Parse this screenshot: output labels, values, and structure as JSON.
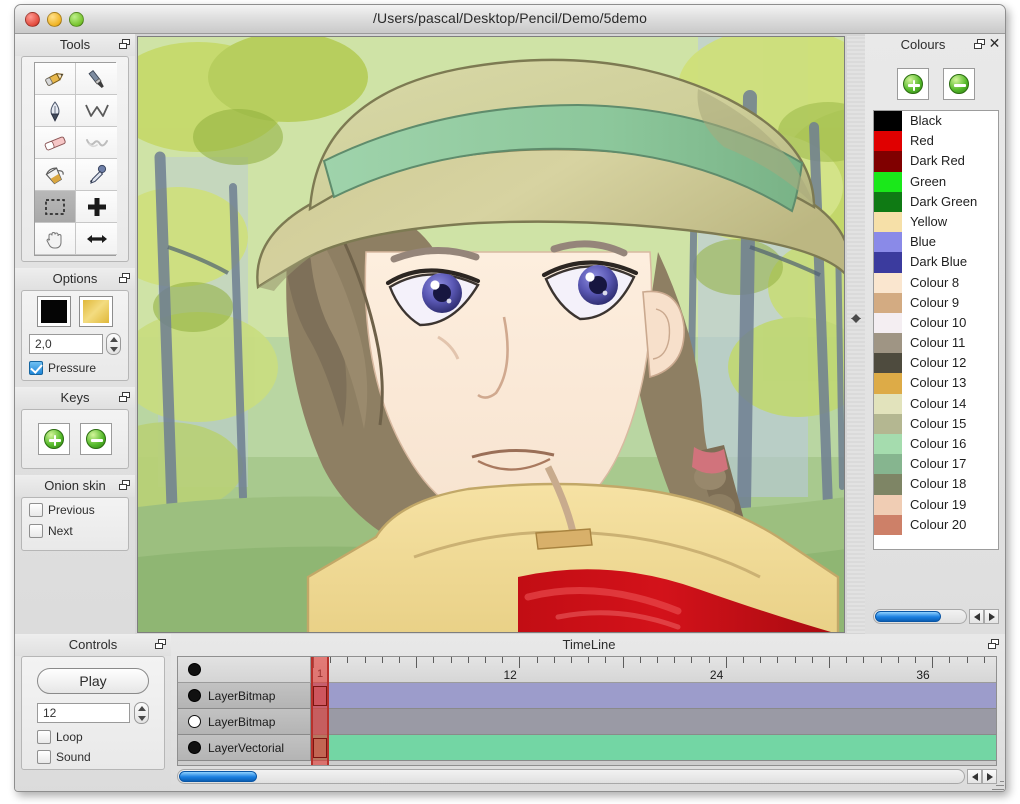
{
  "window": {
    "title": "/Users/pascal/Desktop/Pencil/Demo/5demo",
    "traffic_lights": [
      "close",
      "minimize",
      "maximize"
    ]
  },
  "tools_panel": {
    "title": "Tools",
    "items": [
      {
        "name": "pencil",
        "label": "Pencil",
        "active": false
      },
      {
        "name": "brush",
        "label": "Brush",
        "active": false
      },
      {
        "name": "pen",
        "label": "Pen",
        "active": false
      },
      {
        "name": "polyline",
        "label": "Polyline",
        "active": false
      },
      {
        "name": "eraser",
        "label": "Eraser",
        "active": false
      },
      {
        "name": "smudge",
        "label": "Smudge",
        "active": false
      },
      {
        "name": "bucket",
        "label": "Bucket fill",
        "active": false
      },
      {
        "name": "eyedropper",
        "label": "Eyedropper",
        "active": false
      },
      {
        "name": "select",
        "label": "Select",
        "active": true
      },
      {
        "name": "move",
        "label": "Move",
        "active": false
      },
      {
        "name": "hand",
        "label": "Hand",
        "active": false
      },
      {
        "name": "resize",
        "label": "Resize",
        "active": false
      }
    ]
  },
  "options_panel": {
    "title": "Options",
    "fill_colour": "#050505",
    "stroke_colour": "#e0b83a",
    "width_value": "2,0",
    "pressure_label": "Pressure",
    "pressure_checked": true
  },
  "keys_panel": {
    "title": "Keys",
    "add_label": "Add key",
    "remove_label": "Remove key"
  },
  "onion_panel": {
    "title": "Onion skin",
    "previous_label": "Previous",
    "previous_checked": false,
    "next_label": "Next",
    "next_checked": false
  },
  "controls_panel": {
    "title": "Controls",
    "play_label": "Play",
    "fps_value": "12",
    "loop_label": "Loop",
    "loop_checked": false,
    "sound_label": "Sound",
    "sound_checked": false
  },
  "colours_panel": {
    "title": "Colours",
    "close_glyph": "✕",
    "add_label": "Add colour",
    "remove_label": "Remove colour",
    "swatches": [
      {
        "name": "Black",
        "hex": "#000000"
      },
      {
        "name": "Red",
        "hex": "#e00000"
      },
      {
        "name": "Dark Red",
        "hex": "#800000"
      },
      {
        "name": "Green",
        "hex": "#1ae81a"
      },
      {
        "name": "Dark Green",
        "hex": "#0f7a14"
      },
      {
        "name": "Yellow",
        "hex": "#f6e0a8"
      },
      {
        "name": "Blue",
        "hex": "#8a8ae8"
      },
      {
        "name": "Dark Blue",
        "hex": "#3b3b9e"
      },
      {
        "name": "Colour 8",
        "hex": "#fae6cf"
      },
      {
        "name": "Colour 9",
        "hex": "#d3ab82"
      },
      {
        "name": "Colour 10",
        "hex": "#f4eef2"
      },
      {
        "name": "Colour 11",
        "hex": "#9f9584"
      },
      {
        "name": "Colour 12",
        "hex": "#4e4b3e"
      },
      {
        "name": "Colour 13",
        "hex": "#ddab47"
      },
      {
        "name": "Colour 14",
        "hex": "#e2e3bc"
      },
      {
        "name": "Colour 15",
        "hex": "#b4b791"
      },
      {
        "name": "Colour 16",
        "hex": "#a5dcae"
      },
      {
        "name": "Colour 17",
        "hex": "#86b58f"
      },
      {
        "name": "Colour 18",
        "hex": "#7e8565"
      },
      {
        "name": "Colour 19",
        "hex": "#f0cdb4"
      },
      {
        "name": "Colour 20",
        "hex": "#cd8068"
      }
    ]
  },
  "timeline_panel": {
    "title": "TimeLine",
    "ruler_labels": [
      "1",
      "12",
      "24",
      "36"
    ],
    "current_frame": "1",
    "layers": [
      {
        "name": "LayerBitmap",
        "visible": true,
        "track_colour": "#9c9ccb",
        "has_keyframe": true
      },
      {
        "name": "LayerBitmap",
        "visible": false,
        "track_colour": "#9a9aa5",
        "has_keyframe": false
      },
      {
        "name": "LayerVectorial",
        "visible": true,
        "track_colour": "#73d6a4",
        "has_keyframe": true
      }
    ]
  },
  "canvas": {
    "description": "Illustration of a girl wearing a wide-brimmed khaki hat with a green band, yellow scarf and red coat, standing in a sunlit forest"
  }
}
